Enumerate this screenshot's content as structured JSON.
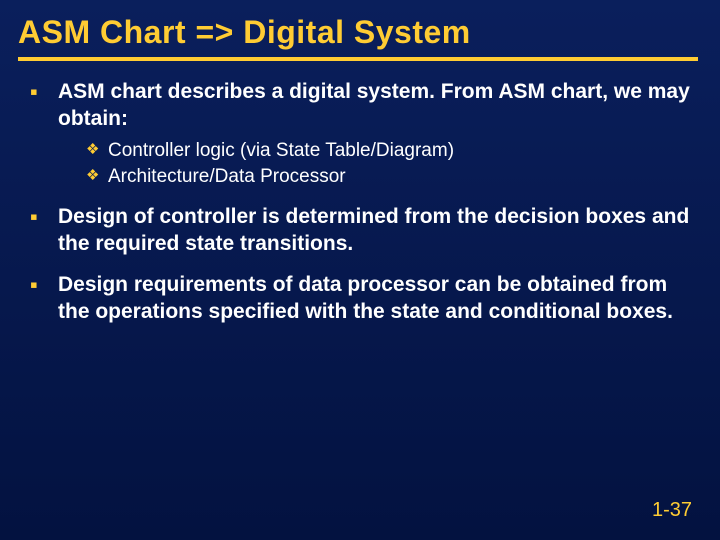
{
  "title": "ASM Chart => Digital System",
  "bullets": [
    {
      "text": "ASM chart describes a digital system.  From ASM chart, we may obtain:",
      "sub": [
        "Controller logic (via State Table/Diagram)",
        "Architecture/Data Processor"
      ]
    },
    {
      "text": "Design of controller is determined from the decision boxes and the required state transitions.",
      "sub": []
    },
    {
      "text": "Design requirements of data processor can be obtained from the operations specified with the state and conditional boxes.",
      "sub": []
    }
  ],
  "page_number": "1-37"
}
